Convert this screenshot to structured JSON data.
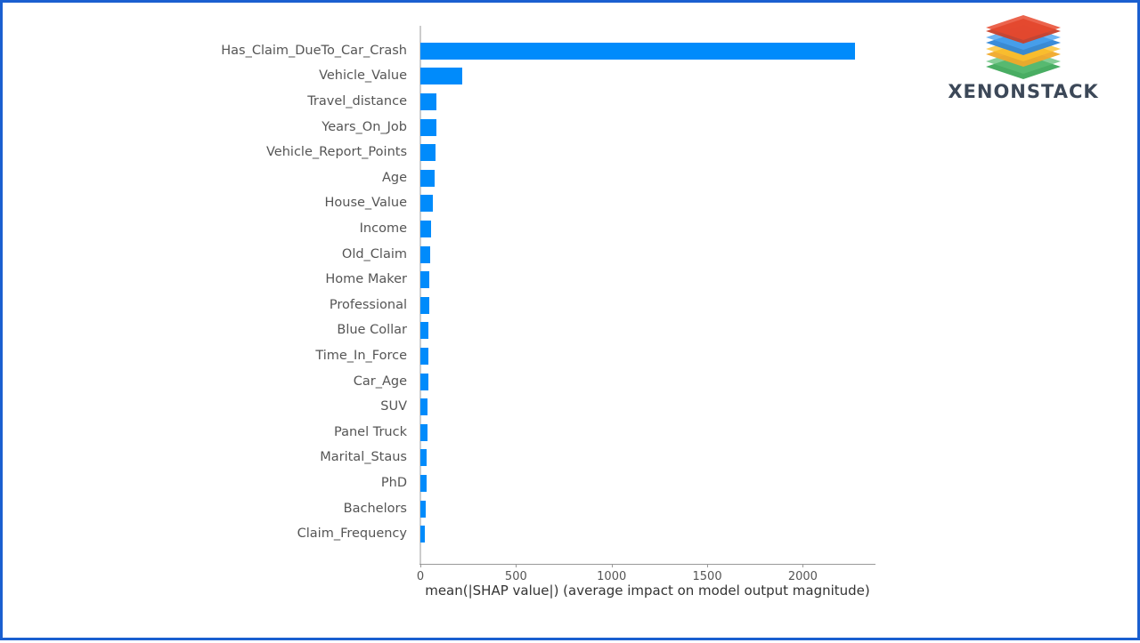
{
  "logo": {
    "name": "xenonstack-logo",
    "wordmark": "XENONSTACK",
    "layer_colors": [
      "#e8492e",
      "#4aa3f0",
      "#fbc02d",
      "#3fa95b"
    ],
    "wordmark_color": "#3c4858"
  },
  "frame": {
    "border_color": "#1a5fd0",
    "background": "#ffffff"
  },
  "chart_data": {
    "type": "bar",
    "orientation": "horizontal",
    "title": "",
    "subtitle": "",
    "xlabel": "mean(|SHAP value|) (average impact on model output magnitude)",
    "ylabel": "",
    "xlim": [
      0,
      2380
    ],
    "xticks": [
      0,
      500,
      1000,
      1500,
      2000
    ],
    "xtick_labels": [
      "0",
      "500",
      "1000",
      "1500",
      "2000"
    ],
    "grid": false,
    "legend": false,
    "bar_color": "#008bfb",
    "categories": [
      "Has_Claim_DueTo_Car_Crash",
      "Vehicle_Value",
      "Travel_distance",
      "Years_On_Job",
      "Vehicle_Report_Points",
      "Age",
      "House_Value",
      "Income",
      "Old_Claim",
      "Home Maker",
      "Professional",
      "Blue Collar",
      "Time_In_Force",
      "Car_Age",
      "SUV",
      "Panel Truck",
      "Marital_Staus",
      "PhD",
      "Bachelors",
      "Claim_Frequency"
    ],
    "values": [
      2275,
      219,
      85,
      84,
      81,
      76,
      63,
      57,
      52,
      48,
      46,
      44,
      42,
      40,
      38,
      36,
      33,
      31,
      27,
      25
    ]
  }
}
